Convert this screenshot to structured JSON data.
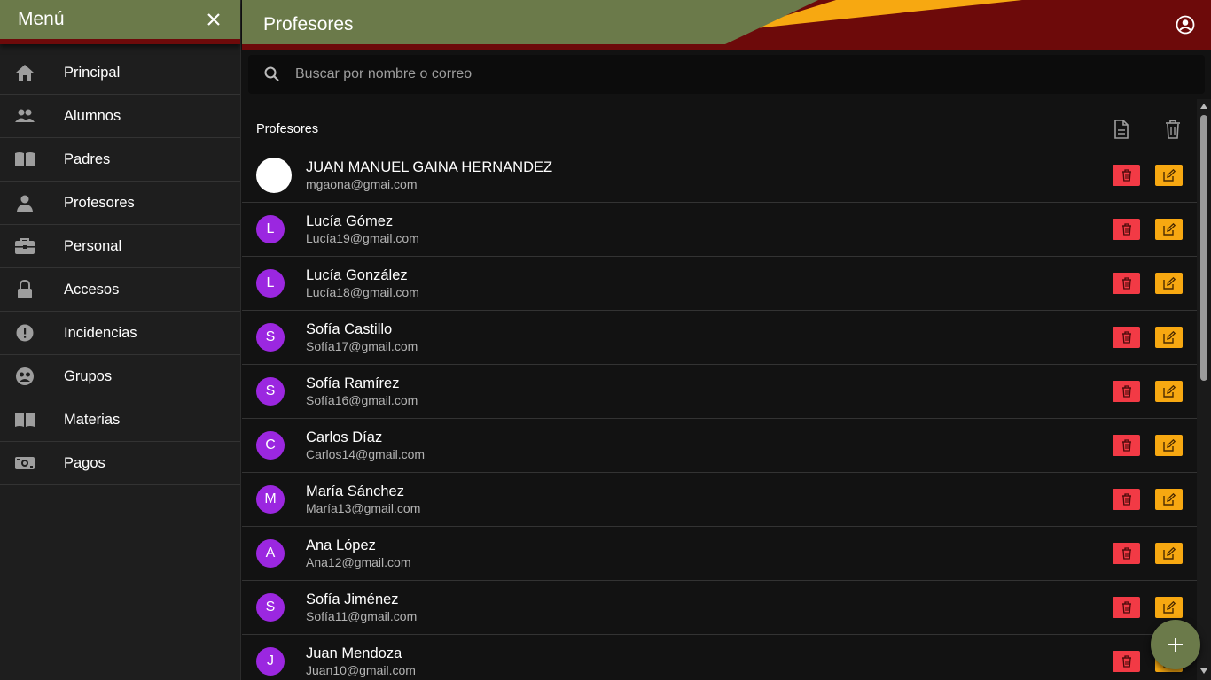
{
  "sidebar": {
    "title": "Menú",
    "items": [
      {
        "label": "Principal",
        "icon": "home-icon"
      },
      {
        "label": "Alumnos",
        "icon": "people-icon"
      },
      {
        "label": "Padres",
        "icon": "book-icon"
      },
      {
        "label": "Profesores",
        "icon": "person-icon"
      },
      {
        "label": "Personal",
        "icon": "briefcase-icon"
      },
      {
        "label": "Accesos",
        "icon": "lock-icon"
      },
      {
        "label": "Incidencias",
        "icon": "alert-icon"
      },
      {
        "label": "Grupos",
        "icon": "group-icon"
      },
      {
        "label": "Materias",
        "icon": "book-icon"
      },
      {
        "label": "Pagos",
        "icon": "money-icon"
      }
    ]
  },
  "header": {
    "title": "Profesores"
  },
  "search": {
    "placeholder": "Buscar por nombre o correo",
    "value": ""
  },
  "list": {
    "title": "Profesores",
    "rows": [
      {
        "initial": "",
        "name": "JUAN MANUEL GAINA HERNANDEZ",
        "email": "mgaona@gmai.com",
        "photo": true
      },
      {
        "initial": "L",
        "name": "Lucía Gómez",
        "email": "Lucía19@gmail.com"
      },
      {
        "initial": "L",
        "name": "Lucía González",
        "email": "Lucía18@gmail.com"
      },
      {
        "initial": "S",
        "name": "Sofía Castillo",
        "email": "Sofía17@gmail.com"
      },
      {
        "initial": "S",
        "name": "Sofía Ramírez",
        "email": "Sofía16@gmail.com"
      },
      {
        "initial": "C",
        "name": "Carlos Díaz",
        "email": "Carlos14@gmail.com"
      },
      {
        "initial": "M",
        "name": "María Sánchez",
        "email": "María13@gmail.com"
      },
      {
        "initial": "A",
        "name": "Ana López",
        "email": "Ana12@gmail.com"
      },
      {
        "initial": "S",
        "name": "Sofía Jiménez",
        "email": "Sofía11@gmail.com"
      },
      {
        "initial": "J",
        "name": "Juan Mendoza",
        "email": "Juan10@gmail.com"
      }
    ]
  },
  "colors": {
    "olive": "#6b7a4a",
    "maroon": "#6d0a0a",
    "gold": "#f7a811",
    "avatar_purple": "#9b27e0",
    "delete_red": "#f23a45"
  }
}
